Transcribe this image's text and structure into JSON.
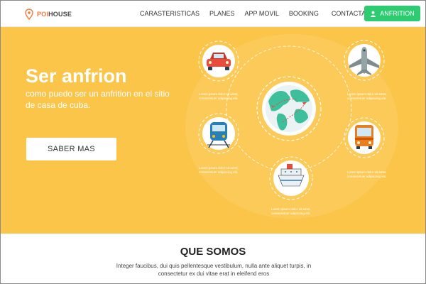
{
  "brand": {
    "prefix": "POI",
    "suffix": "HOUSE"
  },
  "nav": {
    "links": [
      "CARASTERISTICAS",
      "PLANES",
      "APP MOVIL",
      "BOOKING",
      "CONTACTANOS"
    ],
    "cta_label": "ANFRITION"
  },
  "hero": {
    "title": "Ser anfrion",
    "subtitle": "como puedo ser un anfrition en el sitio de casa de cuba.",
    "button_label": "SABER MAS",
    "captions": {
      "car": [
        "Lorem ipsum dolor sit amet,",
        "consectetuer adipiscing elit."
      ],
      "plane": [
        "Lorem ipsum dolor sit amet,",
        "consectetuer adipiscing elit."
      ],
      "train": [
        "Lorem ipsum dolor sit amet,",
        "consectetuer adipiscing elit."
      ],
      "bus": [
        "Lorem ipsum dolor sit amet,",
        "consectetuer adipiscing elit."
      ],
      "ship": [
        "Lorem ipsum dolor sit amet,",
        "consectetuer adipiscing elit."
      ]
    }
  },
  "about": {
    "title": "QUE SOMOS",
    "text": "Integer faucibus, dui quis pellentesque vestibulum, nulla ante aliquet turpis, in consectetur ex dui vitae erat in eleifend eros"
  },
  "colors": {
    "hero_bg": "#fbc54a",
    "cta_green": "#2ecc71",
    "brand_accent": "#f07a3a"
  }
}
